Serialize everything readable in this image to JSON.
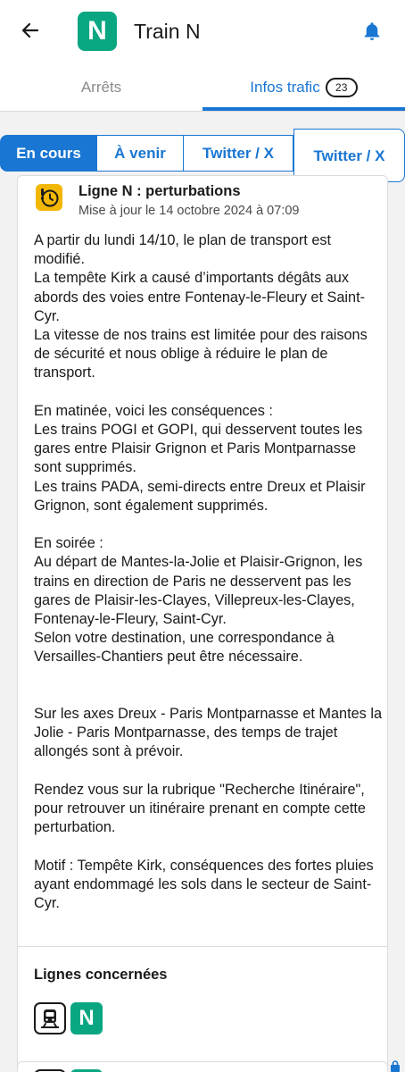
{
  "header": {
    "back_icon": "arrow-left-icon",
    "line_badge": "N",
    "title": "Train N",
    "bell_icon": "bell-icon",
    "brand_color": "#0aa682",
    "accent_color": "#1976d2"
  },
  "tabs": {
    "stops_label": "Arrêts",
    "infos_label": "Infos trafic",
    "infos_count": "23"
  },
  "filters": {
    "current": "En cours",
    "upcoming": "À venir",
    "twitter_1": "Twitter / X",
    "twitter_2": "Twitter / X"
  },
  "alert": {
    "icon": "alert-clock-icon",
    "title": "Ligne N : perturbations",
    "updated": "Mise à jour le 14 octobre 2024 à 07:09",
    "body": "A partir du lundi 14/10, le plan de transport est modifié.\nLa tempête Kirk a causé d’importants dégâts aux abords des voies entre Fontenay-le-Fleury et Saint-Cyr.\nLa vitesse de nos trains est limitée pour des raisons de sécurité et nous oblige à réduire le plan de transport.\n\nEn matinée, voici les conséquences :\nLes trains POGI et GOPI, qui desservent toutes les gares entre Plaisir Grignon et Paris Montparnasse sont supprimés.\nLes trains PADA, semi-directs entre Dreux et Plaisir Grignon, sont également supprimés.\n\nEn soirée :\nAu départ de Mantes-la-Jolie et Plaisir-Grignon, les trains en direction de Paris ne desservent pas les gares de Plaisir-les-Clayes, Villepreux-les-Clayes, Fontenay-le-Fleury, Saint-Cyr.\nSelon votre destination, une correspondance à Versailles-Chantiers peut être nécessaire.\n\n\nSur les axes Dreux - Paris Montparnasse et Mantes la Jolie -  Paris Montparnasse, des temps de trajet allongés sont à prévoir.\n\nRendez vous sur la rubrique \"Recherche Itinéraire\", pour retrouver un itinéraire prenant en compte cette perturbation.\n\nMotif : Tempête Kirk, conséquences des fortes pluies ayant endommagé les sols dans le secteur de Saint-Cyr.",
    "lines_title": "Lignes concernées",
    "train_icon": "train-icon",
    "line_badge": "N",
    "warning_color": "#f2b705"
  }
}
